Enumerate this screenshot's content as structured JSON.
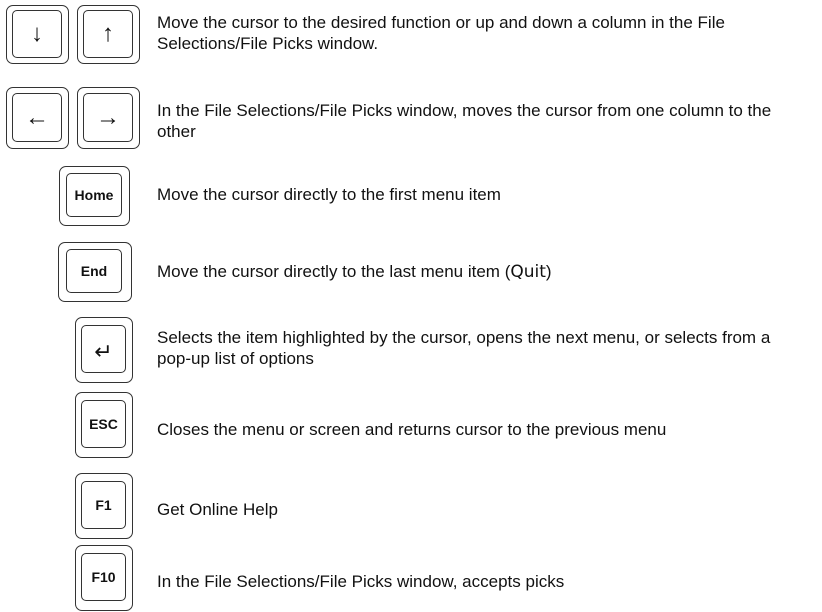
{
  "rows": [
    {
      "keys": [
        {
          "glyph": "↓",
          "icon": "arrow-down-icon"
        },
        {
          "glyph": "↑",
          "icon": "arrow-up-icon"
        }
      ],
      "description": "Move the cursor to the desired function or up and down a column in the File Selections/File Picks window."
    },
    {
      "keys": [
        {
          "glyph": "←",
          "icon": "arrow-left-icon"
        },
        {
          "glyph": "→",
          "icon": "arrow-right-icon"
        }
      ],
      "description": "In the File Selections/File Picks window, moves the cursor from one column to the other"
    },
    {
      "keys": [
        {
          "label": "Home"
        }
      ],
      "description": "Move the cursor directly to the first menu item"
    },
    {
      "keys": [
        {
          "label": "End"
        }
      ],
      "description_prefix": "Move the cursor directly to the last menu item (",
      "description_quit": "Quit",
      "description_suffix": ")"
    },
    {
      "keys": [
        {
          "glyph": "↵",
          "icon": "enter-icon"
        }
      ],
      "description": "Selects the item highlighted by the cursor, opens the next menu, or selects from a pop-up list of options"
    },
    {
      "keys": [
        {
          "label": "ESC"
        }
      ],
      "description": "Closes the menu or screen and returns cursor to the previous menu"
    },
    {
      "keys": [
        {
          "label": "F1"
        }
      ],
      "description": "Get Online Help"
    },
    {
      "keys": [
        {
          "label": "F10"
        }
      ],
      "description": "In the File Selections/File Picks window, accepts picks"
    }
  ]
}
